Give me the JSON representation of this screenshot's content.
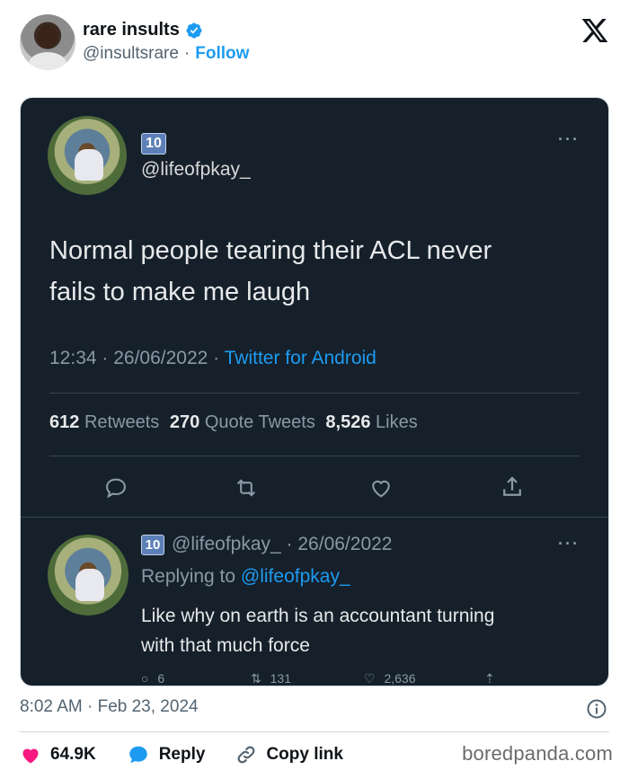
{
  "author": {
    "name": "rare insults",
    "handle": "@insultsrare",
    "separator": "·",
    "follow_label": "Follow"
  },
  "embedded": {
    "emoji_label": "10",
    "handle": "@lifeofpkay_",
    "text_line1": "Normal people tearing their ACL never",
    "text_line2": "fails to make me laugh",
    "time": "12:34 · 26/06/2022 ·",
    "source": "Twitter for Android",
    "stats": {
      "retweets_count": "612",
      "retweets_label": "Retweets",
      "quotes_count": "270",
      "quotes_label": "Quote Tweets",
      "likes_count": "8,526",
      "likes_label": "Likes"
    },
    "reply": {
      "handle_date": "@lifeofpkay_ · 26/06/2022",
      "replying_to_label": "Replying to",
      "replying_to_handle": "@lifeofpkay_",
      "text_line1": "Like why on earth is an accountant turning",
      "text_line2": "with that much force",
      "reply_count": "6",
      "retweet_count": "131",
      "like_count": "2,636"
    }
  },
  "footer": {
    "timestamp": "8:02 AM · Feb 23, 2024",
    "likes": "64.9K",
    "reply_label": "Reply",
    "copy_link_label": "Copy link",
    "watermark": "boredpanda.com"
  },
  "colors": {
    "accent": "#1d9bf0",
    "like": "#f91880",
    "embed_bg": "#15202b"
  }
}
